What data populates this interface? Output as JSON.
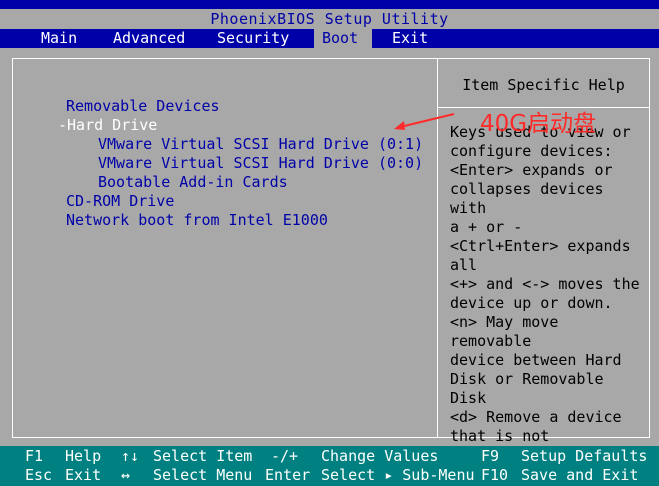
{
  "window": {
    "title": "PhoenixBIOS Setup Utility"
  },
  "menu": {
    "items": [
      {
        "label": "Main"
      },
      {
        "label": "Advanced"
      },
      {
        "label": "Security"
      },
      {
        "label": "Boot"
      },
      {
        "label": "Exit"
      }
    ],
    "active": "Boot"
  },
  "boot_list": {
    "removable": "Removable Devices",
    "hard_drive": "-Hard Drive",
    "hdd_1": "VMware Virtual SCSI Hard Drive (0:1)",
    "hdd_0": "VMware Virtual SCSI Hard Drive (0:0)",
    "addin": "Bootable Add-in Cards",
    "cdrom": "CD-ROM Drive",
    "network": "Network boot from Intel E1000"
  },
  "help": {
    "title": "Item Specific Help",
    "text": "Keys used to view or\nconfigure devices:\n<Enter> expands or\ncollapses devices with\na + or -\n<Ctrl+Enter> expands\nall\n<+> and <-> moves the\ndevice up or down.\n<n> May move removable\ndevice between Hard\nDisk or Removable Disk\n<d> Remove a device\nthat is not installed."
  },
  "annotation": {
    "text": "40G启动盘",
    "color": "#ff2a2a",
    "icon": "arrow-left-icon"
  },
  "keys": {
    "f1": "F1",
    "help": "Help",
    "updown": "↑↓",
    "select_item": "Select Item",
    "minus_plus": "-/+",
    "change_values": "Change Values",
    "f9": "F9",
    "setup_defaults": "Setup Defaults",
    "esc": "Esc",
    "exit": "Exit",
    "leftright": "↔",
    "select_menu": "Select Menu",
    "enter": "Enter",
    "select_submenu": "Select ▸ Sub-Menu",
    "f10": "F10",
    "save_exit": "Save and Exit"
  },
  "colors": {
    "bios_blue": "#0000a8",
    "bios_gray": "#a8a8a8",
    "keybar_teal": "#008080"
  }
}
